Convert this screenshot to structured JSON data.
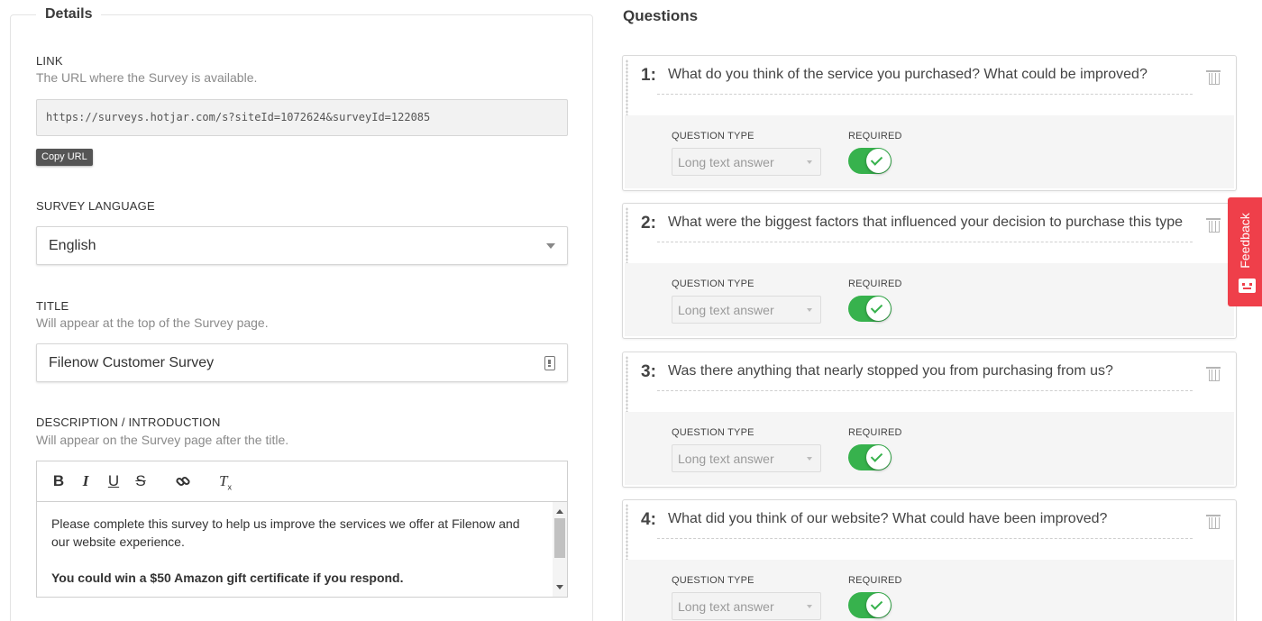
{
  "details": {
    "legend": "Details",
    "link": {
      "label": "LINK",
      "hint": "The URL where the Survey is available.",
      "url": "https://surveys.hotjar.com/s?siteId=1072624&surveyId=122085",
      "copy_label": "Copy URL"
    },
    "language": {
      "label": "SURVEY LANGUAGE",
      "selected": "English"
    },
    "title": {
      "label": "TITLE",
      "hint": "Will appear at the top of the Survey page.",
      "value": "Filenow Customer Survey"
    },
    "description": {
      "label": "DESCRIPTION / INTRODUCTION",
      "hint": "Will appear on the Survey page after the title.",
      "toolbar": {
        "bold": "B",
        "italic": "I",
        "underline": "U",
        "strike": "S",
        "clear": "T",
        "clear_sub": "x"
      },
      "paragraph": "Please complete this survey to help us improve the services we offer at Filenow and our website experience.",
      "bold_paragraph": "You could win a $50 Amazon gift certificate if you respond."
    }
  },
  "questions": {
    "heading": "Questions",
    "items": [
      {
        "number": "1:",
        "text": "What do you think of the service you purchased? What could be improved?",
        "type_label": "QUESTION TYPE",
        "type": "Long text answer",
        "required_label": "REQUIRED",
        "required": true
      },
      {
        "number": "2:",
        "text": "What were the biggest factors that influenced your decision to purchase this type",
        "type_label": "QUESTION TYPE",
        "type": "Long text answer",
        "required_label": "REQUIRED",
        "required": true
      },
      {
        "number": "3:",
        "text": "Was there anything that nearly stopped you from purchasing from us?",
        "type_label": "QUESTION TYPE",
        "type": "Long text answer",
        "required_label": "REQUIRED",
        "required": true
      },
      {
        "number": "4:",
        "text": "What did you think of our website? What could have been improved?",
        "type_label": "QUESTION TYPE",
        "type": "Long text answer",
        "required_label": "REQUIRED",
        "required": true
      }
    ]
  },
  "feedback_tab": {
    "label": "Feedback",
    "color": "#ef3f4a"
  },
  "colors": {
    "toggle_on": "#37b24d"
  },
  "icons": [
    "copy-url-button",
    "dropdown-caret-icon",
    "autofill-icon",
    "bold-icon",
    "italic-icon",
    "underline-icon",
    "strikethrough-icon",
    "link-icon",
    "clear-format-icon",
    "trash-icon",
    "drag-handle-icon",
    "checkmark-icon",
    "feedback-face-icon"
  ]
}
